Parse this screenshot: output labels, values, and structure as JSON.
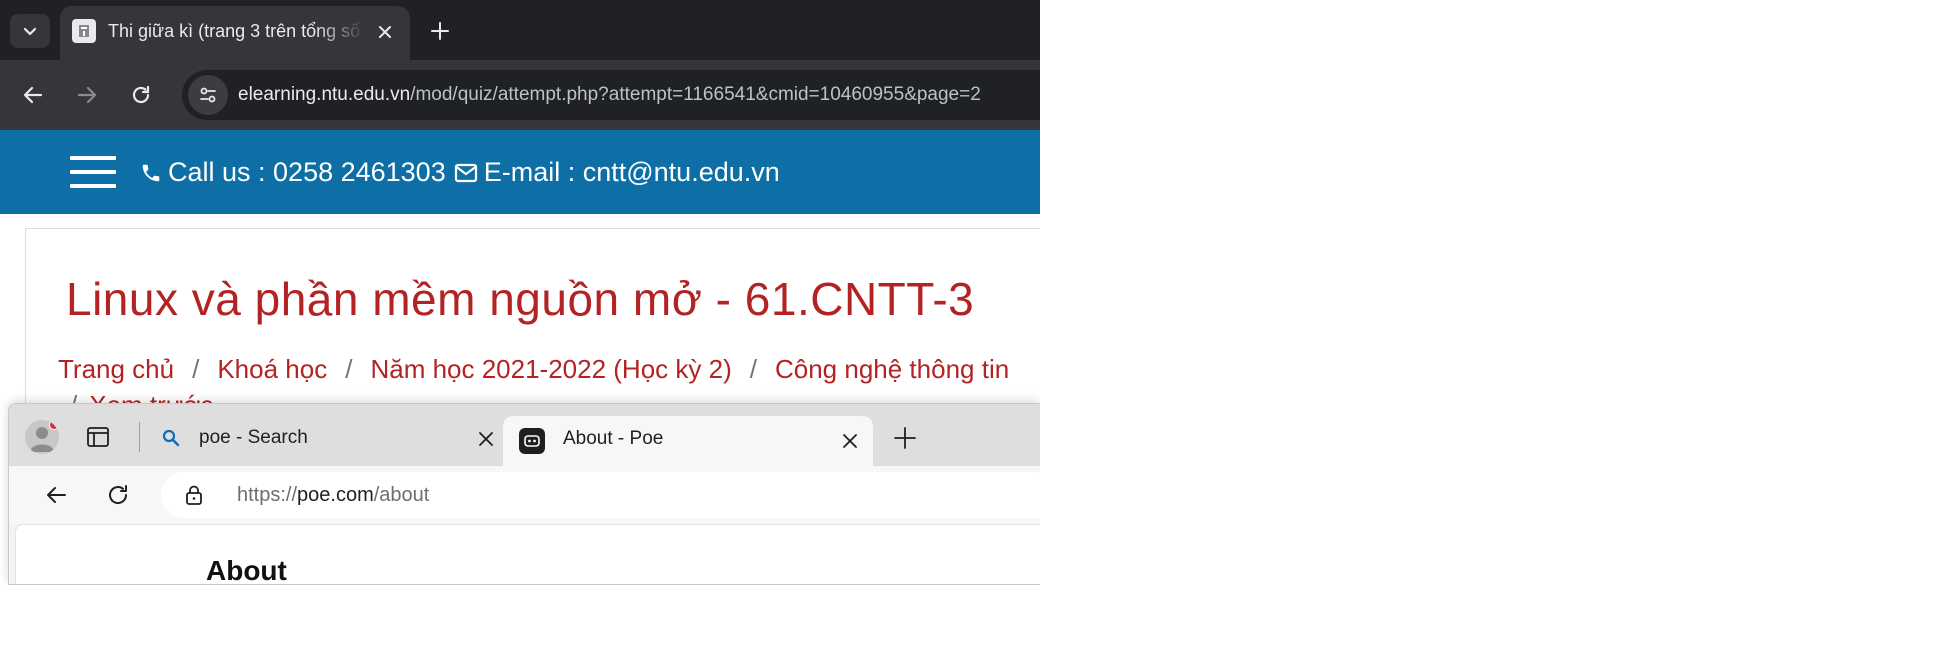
{
  "back_browser": {
    "tab": {
      "title": "Thi giữa kì (trang 3 trên tổng số",
      "close_glyph": "✕"
    },
    "new_tab_glyph": "+",
    "address": {
      "host": "elearning.ntu.edu.vn",
      "path": "/mod/quiz/attempt.php?attempt=1166541&cmid=10460955&page=2"
    },
    "icons": {
      "tab_search": "chevron-down-icon",
      "favicon": "moodle-icon",
      "back": "arrow-left-icon",
      "forward": "arrow-right-icon",
      "reload": "reload-icon",
      "site_info": "tune-icon"
    }
  },
  "site": {
    "phone_text": "Call us : 0258 2461303",
    "email_text": "E-mail : cntt@ntu.edu.vn",
    "course_title": "Linux và phần mềm nguồn mở - 61.CNTT-3",
    "breadcrumb": [
      "Trang chủ",
      "Khoá học",
      "Năm học 2021-2022 (Học kỳ 2)",
      "Công nghệ thông tin"
    ],
    "breadcrumb_sep": "/",
    "breadcrumb_next": "Xem trước",
    "colors": {
      "header_bg": "#0d6fa5",
      "title_red": "#b42323"
    }
  },
  "front_browser": {
    "tabs": [
      {
        "title": "poe - Search",
        "close_glyph": "✕"
      },
      {
        "title": "About - Poe",
        "close_glyph": "✕"
      }
    ],
    "new_tab_glyph": "+",
    "address": {
      "scheme": "https://",
      "host": "poe.com",
      "path": "/about"
    },
    "page_heading": "About",
    "icons": {
      "profile": "avatar-icon",
      "workspaces": "workspaces-icon",
      "search_tab": "search-icon",
      "poe_tab": "poe-logo-icon",
      "back": "arrow-left-icon",
      "reload": "reload-icon",
      "lock": "lock-icon"
    }
  }
}
